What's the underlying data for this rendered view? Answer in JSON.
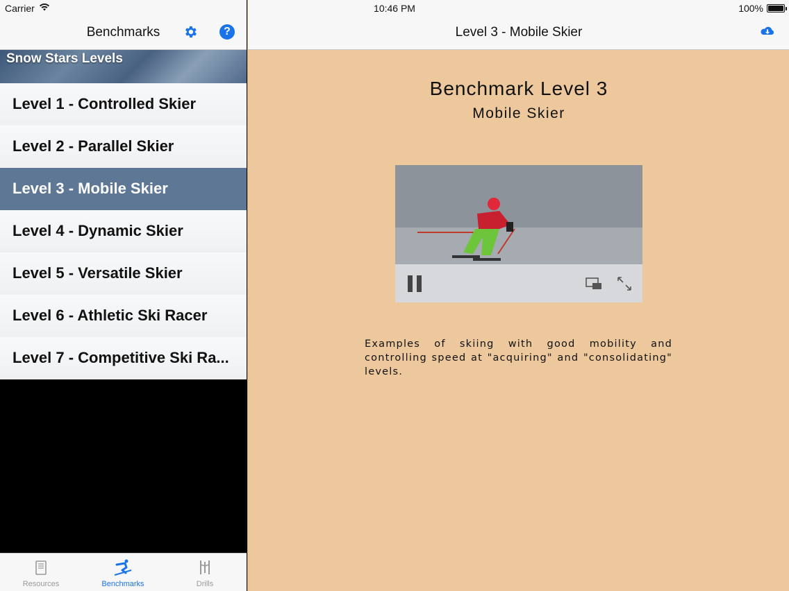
{
  "status_bar": {
    "carrier": "Carrier",
    "time": "10:46 PM",
    "battery": "100%"
  },
  "master": {
    "nav_title": "Benchmarks",
    "icons": {
      "settings": "gear-icon",
      "help": "help-icon",
      "help_glyph": "?"
    },
    "section_header": "Snow Stars Levels",
    "levels": [
      {
        "label": "Level 1 - Controlled Skier",
        "selected": false
      },
      {
        "label": "Level 2 - Parallel Skier",
        "selected": false
      },
      {
        "label": "Level 3 - Mobile Skier",
        "selected": true
      },
      {
        "label": "Level 4 - Dynamic Skier",
        "selected": false
      },
      {
        "label": "Level 5 - Versatile Skier",
        "selected": false
      },
      {
        "label": "Level 6 - Athletic Ski Racer",
        "selected": false
      },
      {
        "label": "Level 7 - Competitive Ski Ra...",
        "selected": false
      }
    ]
  },
  "tabbar": {
    "tabs": [
      {
        "label": "Resources",
        "icon": "book-icon",
        "active": false
      },
      {
        "label": "Benchmarks",
        "icon": "skier-icon",
        "active": true
      },
      {
        "label": "Drills",
        "icon": "drills-icon",
        "active": false
      }
    ]
  },
  "detail": {
    "nav_title": "Level 3 - Mobile Skier",
    "cloud_icon": "cloud-download-icon",
    "heading": "Benchmark Level 3",
    "subheading": "Mobile Skier",
    "video_state": "playing",
    "description": "Examples of skiing with good mobility and controlling speed at \"acquiring\" and \"consolidating\" levels."
  },
  "colors": {
    "accent": "#1a73e8",
    "selected_row": "#5d7795",
    "detail_bg": "#ecc89c"
  }
}
